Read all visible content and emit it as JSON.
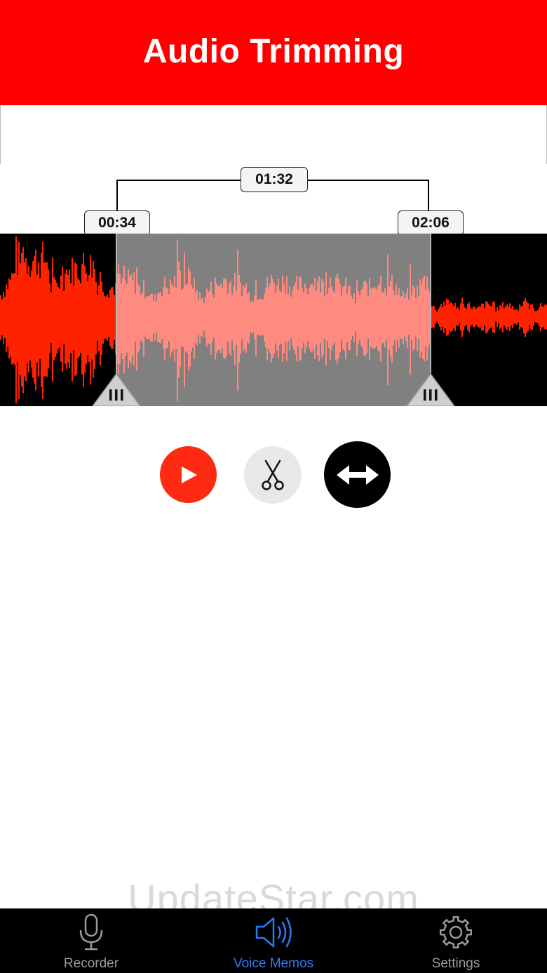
{
  "header": {
    "title": "Audio Trimming",
    "background": "#ff0000"
  },
  "trim": {
    "start_time": "00:34",
    "end_time": "02:06",
    "duration": "01:32"
  },
  "waveform": {
    "track_color": "#ff2200",
    "selected_color": "#ff8a80",
    "selection_background": "#808080",
    "background": "#000000"
  },
  "controls": {
    "play": {
      "icon": "play-icon",
      "color": "#ff2a12"
    },
    "cut": {
      "icon": "scissors-icon",
      "color": "#e8e8e8"
    },
    "expand": {
      "icon": "horizontal-arrows-icon",
      "color": "#000000"
    }
  },
  "watermark": "UpdateStar.com",
  "tabbar": {
    "active_color": "#2d7bf4",
    "inactive_color": "#9a9a9a",
    "tabs": [
      {
        "label": "Recorder",
        "icon": "microphone-icon",
        "active": false
      },
      {
        "label": "Voice Memos",
        "icon": "speaker-icon",
        "active": true
      },
      {
        "label": "Settings",
        "icon": "gear-icon",
        "active": false
      }
    ]
  }
}
